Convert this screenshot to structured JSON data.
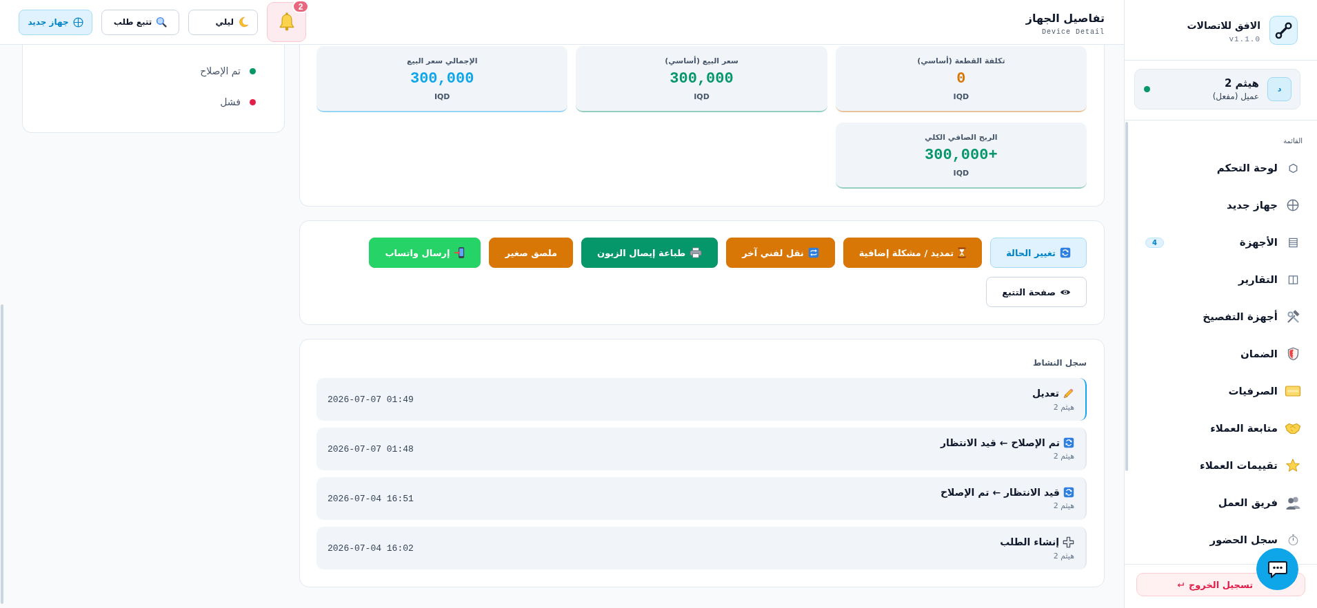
{
  "sidebar": {
    "brand": {
      "title": "الافق للاتصالات",
      "version": "v1.1.0"
    },
    "user": {
      "initial": "د",
      "name": "هيثم 2",
      "role": "عميل (مفعل)",
      "online": true
    },
    "section_label": "القائمة",
    "items": [
      {
        "label": "لوحة التحكم",
        "kind": "dashboard",
        "selected": false
      },
      {
        "label": "جهاز جديد",
        "kind": "add",
        "selected": false
      },
      {
        "label": "الأجهزة",
        "kind": "devices",
        "selected": false,
        "badge": "4"
      },
      {
        "label": "التقارير",
        "kind": "reports",
        "selected": false
      },
      {
        "label": "أجهزة التفصيخ",
        "kind": "parts",
        "selected": false
      },
      {
        "label": "الضمان",
        "kind": "warranty",
        "selected": false
      },
      {
        "label": "الصرفيات",
        "kind": "expenses",
        "selected": false
      },
      {
        "label": "متابعة العملاء",
        "kind": "followup",
        "selected": false
      },
      {
        "label": "تقييمات العملاء",
        "kind": "ratings",
        "selected": false
      },
      {
        "label": "فريق العمل",
        "kind": "team",
        "selected": false
      },
      {
        "label": "سجل الحضور",
        "kind": "attendance",
        "selected": false
      }
    ],
    "logout": "تسجيل الخروج"
  },
  "topbar": {
    "title": "تفاصيل الجهاز",
    "subtitle": "Device Detail",
    "notifications": {
      "count": "2"
    },
    "buttons": [
      {
        "label": "ليلي",
        "kind": "theme"
      },
      {
        "label": "تتبع طلب",
        "kind": "track"
      },
      {
        "label": "جهاز جديد",
        "kind": "new"
      }
    ]
  },
  "legend": [
    {
      "label": "تم الإصلاح",
      "color": "#059669"
    },
    {
      "label": "فشل",
      "color": "#e11d48"
    }
  ],
  "stats": [
    {
      "label": "تكلفة القطعة (أساسي)",
      "value": "0",
      "unit": "IQD",
      "color": "#d97706"
    },
    {
      "label": "سعر البيع (أساسي)",
      "value": "300,000",
      "unit": "IQD",
      "color": "#059669"
    },
    {
      "label": "الإجمالي سعر البيع",
      "value": "300,000",
      "unit": "IQD",
      "color": "#0ea5e9"
    },
    {
      "label": "الربح الصافي الكلي",
      "value": "+300,000",
      "unit": "IQD",
      "color": "#059669"
    }
  ],
  "actions": [
    {
      "label": "تغيير الحالة",
      "kind": "status"
    },
    {
      "label": "تمديد / مشكلة إضافية",
      "kind": "extend"
    },
    {
      "label": "نقل لفني آخر",
      "kind": "transfer"
    },
    {
      "label": "طباعة إيصال الزبون",
      "kind": "print"
    },
    {
      "label": "ملصق صغير",
      "kind": "sticker"
    },
    {
      "label": "إرسال واتساب",
      "kind": "whatsapp"
    },
    {
      "label": "صفحة التتبع",
      "kind": "tracking"
    }
  ],
  "activity": {
    "title": "سجل النشاط",
    "entries": [
      {
        "title": "تعديل",
        "kind": "edit",
        "user": "هيثم 2",
        "time": "2026-07-07 01:49",
        "highlighted": true
      },
      {
        "title": "تم الإصلاح ← قيد الانتظار",
        "kind": "status",
        "user": "هيثم 2",
        "time": "2026-07-07 01:48",
        "highlighted": false
      },
      {
        "title": "قيد الانتظار ← تم الإصلاح",
        "kind": "status",
        "user": "هيثم 2",
        "time": "2026-07-04 16:51",
        "highlighted": false
      },
      {
        "title": "إنشاء الطلب",
        "kind": "create",
        "user": "هيثم 2",
        "time": "2026-07-04 16:02",
        "highlighted": false
      }
    ]
  }
}
